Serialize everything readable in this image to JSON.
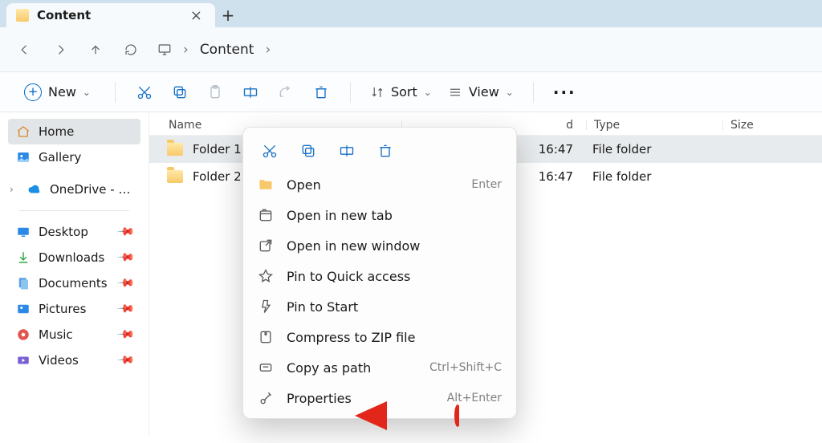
{
  "tab": {
    "title": "Content",
    "close": "×",
    "new": "+"
  },
  "nav": {
    "back": "←",
    "forward": "→",
    "up": "↑",
    "refresh": "⟳"
  },
  "breadcrumb": {
    "root_icon": "monitor",
    "sep": "›",
    "folder": "Content"
  },
  "toolbar": {
    "new_label": "New",
    "sort_label": "Sort",
    "view_label": "View",
    "more": "···"
  },
  "sidebar": {
    "home": "Home",
    "gallery": "Gallery",
    "onedrive": "OneDrive - Perso",
    "desktop": "Desktop",
    "downloads": "Downloads",
    "documents": "Documents",
    "pictures": "Pictures",
    "music": "Music",
    "videos": "Videos"
  },
  "columns": {
    "name": "Name",
    "date": "d",
    "type": "Type",
    "size": "Size"
  },
  "rows": [
    {
      "name": "Folder 1",
      "date": "16:47",
      "type": "File folder",
      "size": ""
    },
    {
      "name": "Folder 2",
      "date": "16:47",
      "type": "File folder",
      "size": ""
    }
  ],
  "ctx": {
    "open": "Open",
    "open_hint": "Enter",
    "open_tab": "Open in new tab",
    "open_win": "Open in new window",
    "pin_quick": "Pin to Quick access",
    "pin_start": "Pin to Start",
    "zip": "Compress to ZIP file",
    "copy_path": "Copy as path",
    "copy_path_hint": "Ctrl+Shift+C",
    "properties": "Properties",
    "properties_hint": "Alt+Enter"
  }
}
